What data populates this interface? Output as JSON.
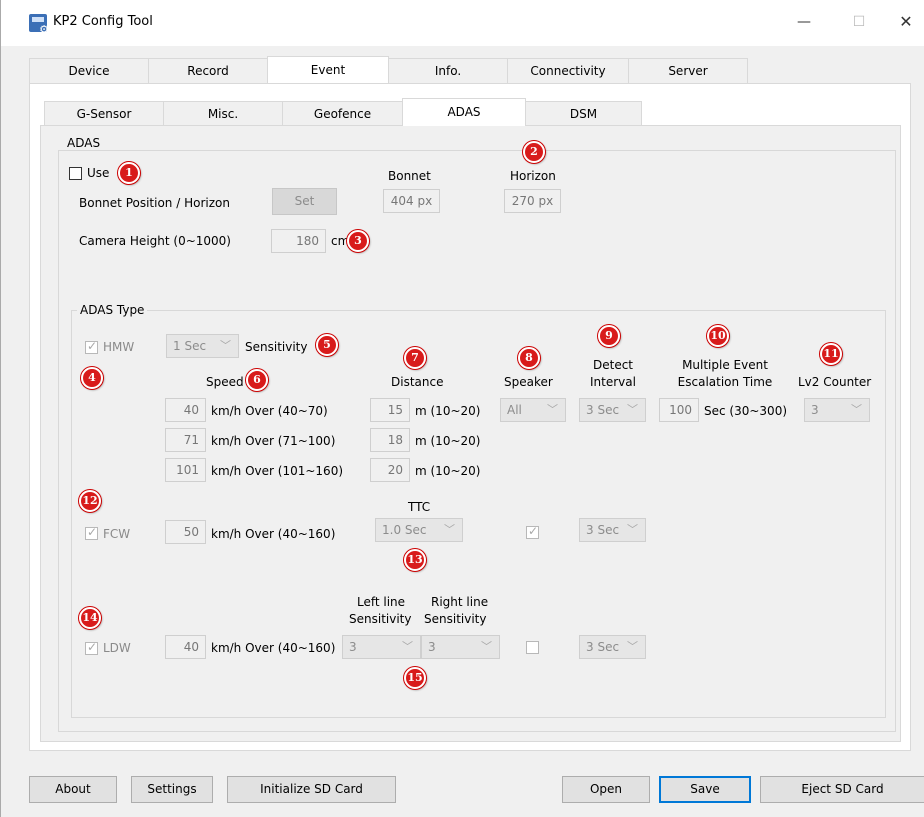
{
  "window": {
    "title": "KP2 Config Tool",
    "minimize": "—",
    "maximize": "☐",
    "close": "✕"
  },
  "main_tabs": [
    {
      "label": "Device"
    },
    {
      "label": "Record"
    },
    {
      "label": "Event"
    },
    {
      "label": "Info."
    },
    {
      "label": "Connectivity"
    },
    {
      "label": "Server"
    }
  ],
  "main_tabs_active": "Event",
  "sub_tabs": [
    {
      "label": "G-Sensor"
    },
    {
      "label": "Misc."
    },
    {
      "label": "Geofence"
    },
    {
      "label": "ADAS"
    },
    {
      "label": "DSM"
    }
  ],
  "sub_tabs_active": "ADAS",
  "adas": {
    "group_title": "ADAS",
    "use_label": "Use",
    "use_checked": false,
    "bonnet_header": "Bonnet",
    "horizon_header": "Horizon",
    "bonnet_position_label": "Bonnet Position / Horizon",
    "set_button": "Set",
    "bonnet_value": "404 px",
    "horizon_value": "270 px",
    "camera_height_label": "Camera Height (0~1000)",
    "camera_height_value": "180",
    "camera_height_unit": "cm"
  },
  "adas_type": {
    "group_title": "ADAS Type",
    "hmw": {
      "label": "HMW",
      "checked": true,
      "time": "1 Sec",
      "sensitivity_label": "Sensitivity",
      "speed_header": "Speed",
      "distance_header": "Distance",
      "rows": [
        {
          "speed": "40",
          "speed_range": "km/h Over (40~70)",
          "distance": "15",
          "distance_range": "m (10~20)"
        },
        {
          "speed": "71",
          "speed_range": "km/h Over (71~100)",
          "distance": "18",
          "distance_range": "m (10~20)"
        },
        {
          "speed": "101",
          "speed_range": "km/h Over (101~160)",
          "distance": "20",
          "distance_range": "m (10~20)"
        }
      ]
    },
    "speaker_header": "Speaker",
    "speaker_value": "All",
    "detect_interval_header_1": "Detect",
    "detect_interval_header_2": "Interval",
    "detect_interval_value": "3 Sec",
    "escalation_header_1": "Multiple Event",
    "escalation_header_2": "Escalation Time",
    "escalation_value": "100",
    "escalation_range": "Sec (30~300)",
    "lv2_header": "Lv2 Counter",
    "lv2_value": "3",
    "fcw": {
      "label": "FCW",
      "checked": true,
      "speed": "50",
      "speed_range": "km/h Over (40~160)",
      "ttc_header": "TTC",
      "ttc_value": "1.0 Sec",
      "speaker_checked": true,
      "interval": "3 Sec"
    },
    "ldw": {
      "label": "LDW",
      "checked": true,
      "speed": "40",
      "speed_range": "km/h Over (40~160)",
      "left_header_1": "Left line",
      "left_header_2": "Sensitivity",
      "left_value": "3",
      "right_header_1": "Right line",
      "right_header_2": "Sensitivity",
      "right_value": "3",
      "speaker_checked": false,
      "interval": "3 Sec"
    }
  },
  "badges": [
    "1",
    "2",
    "3",
    "4",
    "5",
    "6",
    "7",
    "8",
    "9",
    "10",
    "11",
    "12",
    "13",
    "14",
    "15"
  ],
  "footer": {
    "about": "About",
    "settings": "Settings",
    "init_sd": "Initialize SD Card",
    "open": "Open",
    "save": "Save",
    "eject_sd": "Eject SD Card"
  },
  "icons": {
    "dropdown": "chevron-down-icon",
    "app": "config-tool-icon"
  },
  "colors": {
    "badge": "#d81b1b",
    "primary_border": "#0078d7",
    "panel": "#f0f0f0"
  }
}
